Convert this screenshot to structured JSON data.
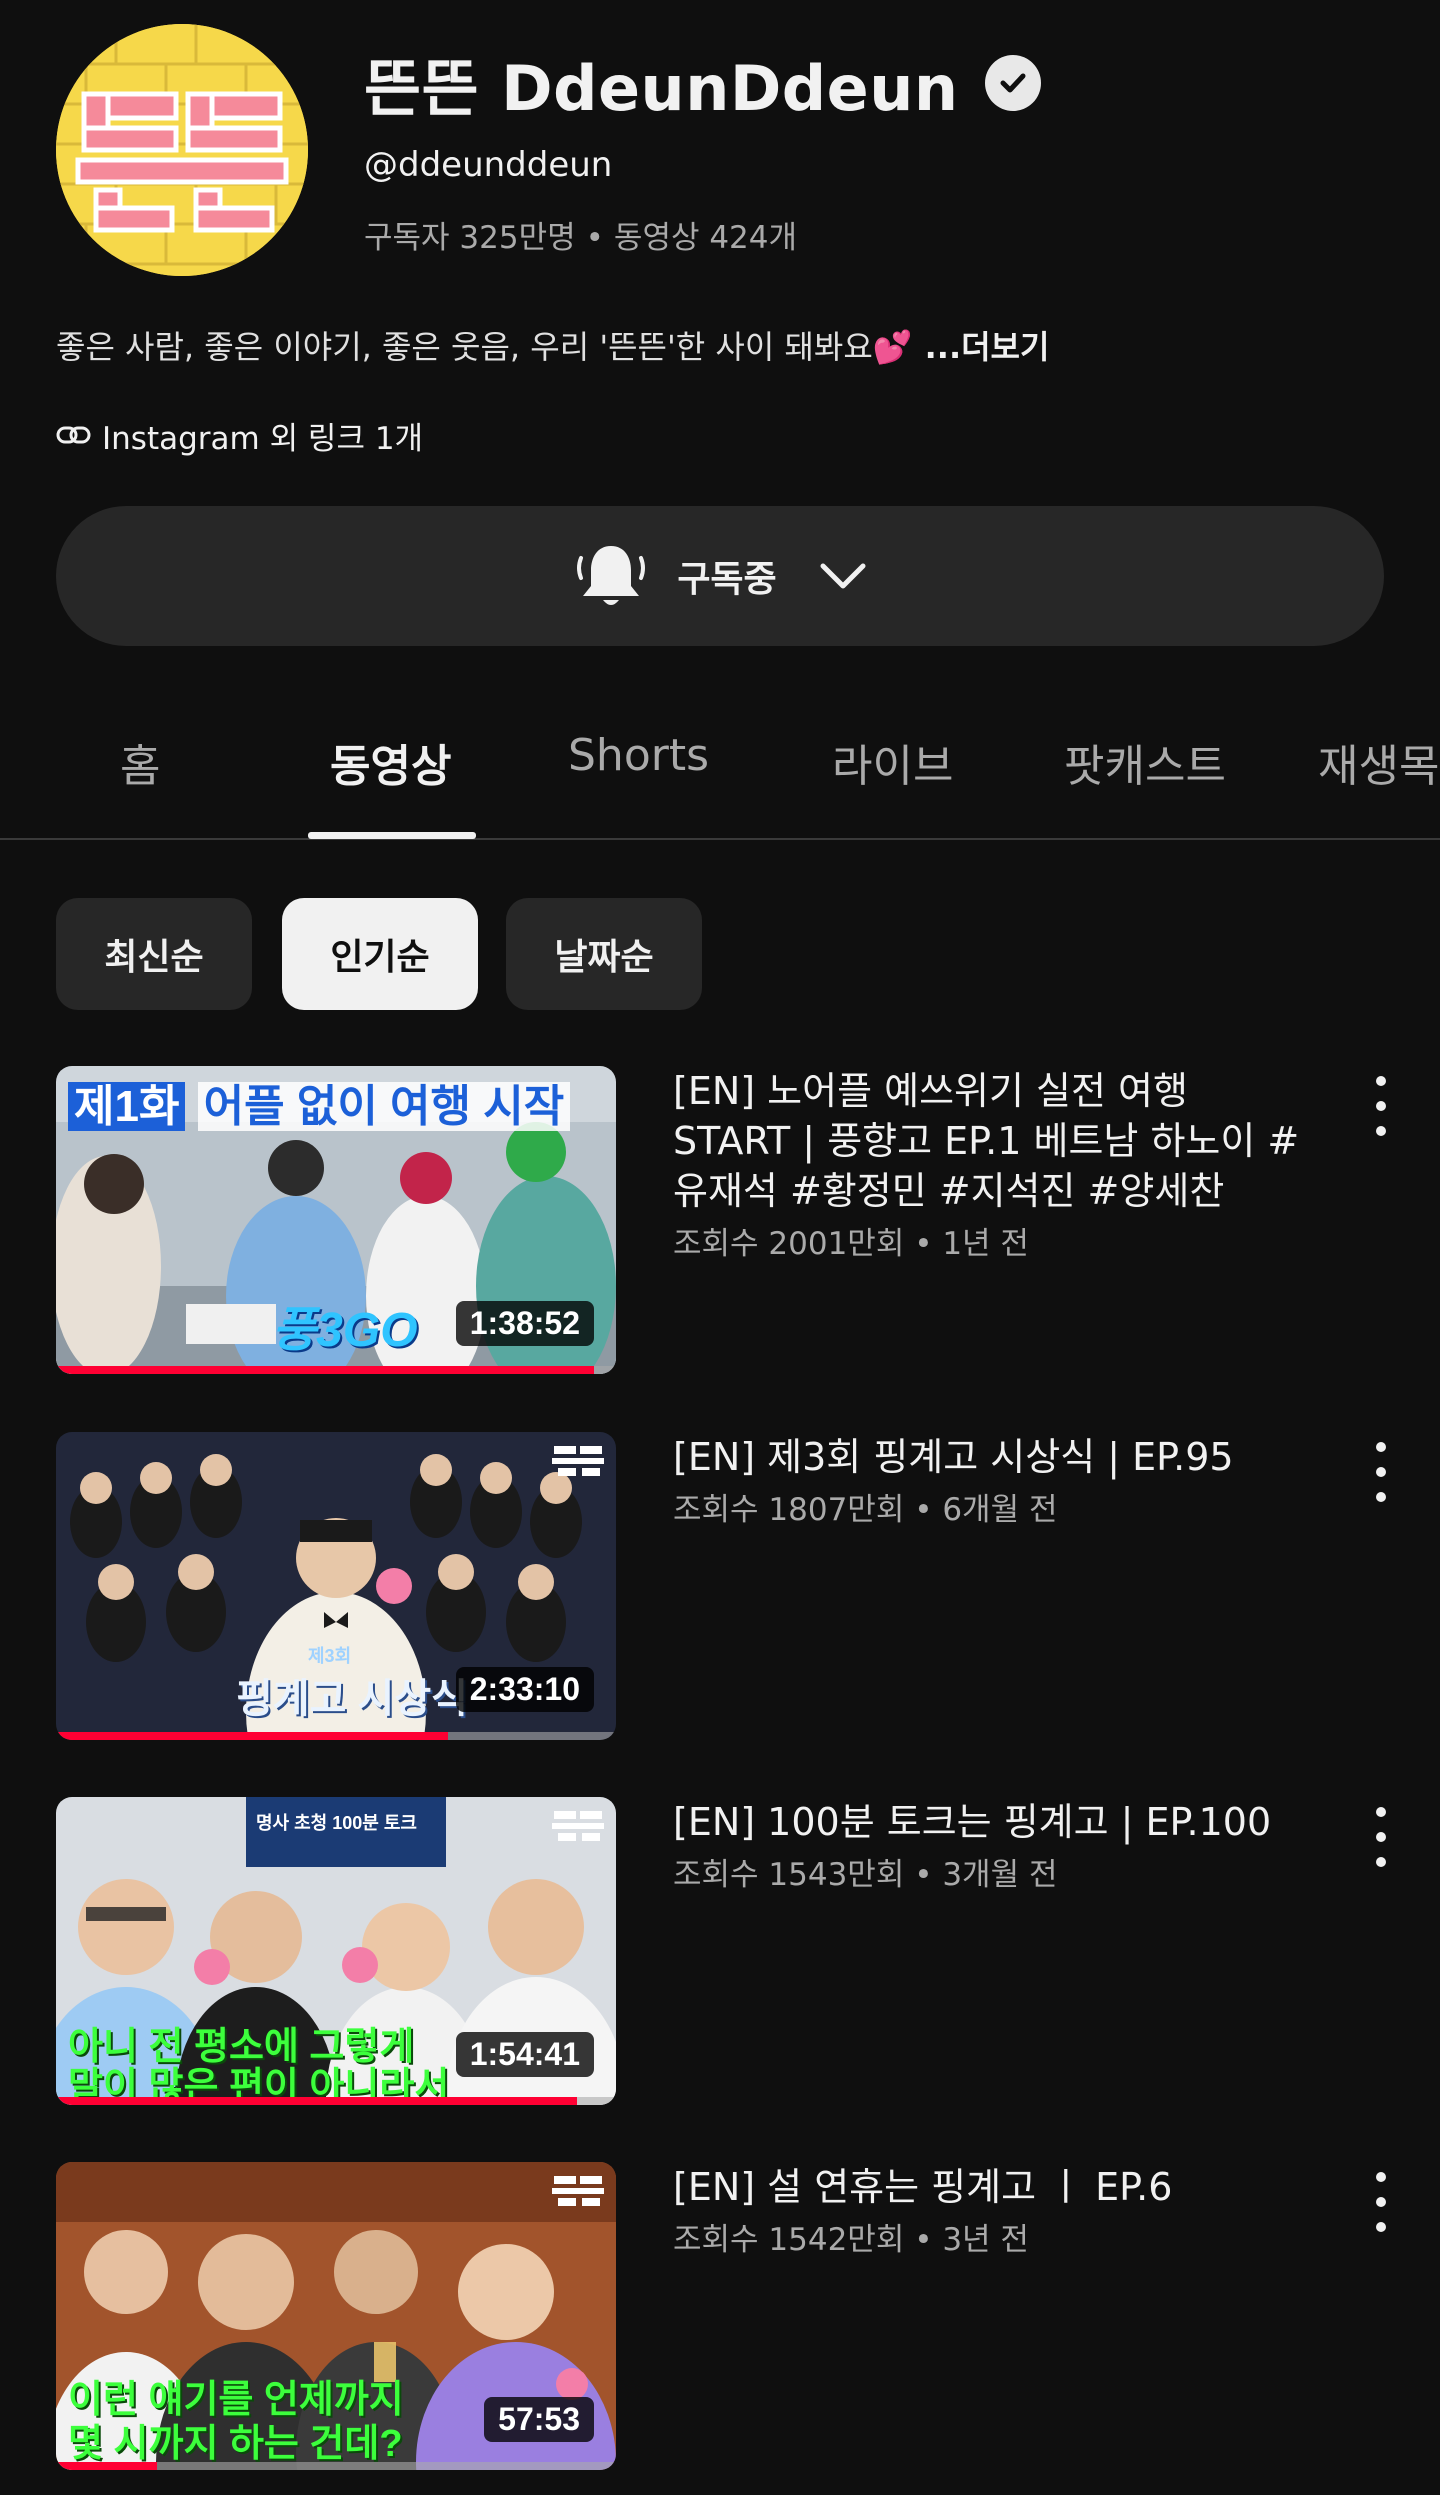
{
  "channel": {
    "name": "뜬뜬 DdeunDdeun",
    "avatar_text": "뜬뜬",
    "handle": "@ddeunddeun",
    "subscribers": "구독자 325만명",
    "video_count": "동영상 424개",
    "stats_separator": "•",
    "description": "좋은 사람, 좋은 이야기, 좋은 웃음, 우리 '뜬뜬'한 사이 돼봐요💕",
    "more_label": "...더보기",
    "links": "Instagram 외 링크 1개"
  },
  "subscribe": {
    "label": "구독중"
  },
  "tabs": [
    "홈",
    "동영상",
    "Shorts",
    "라이브",
    "팟캐스트",
    "재생목록"
  ],
  "sort_chips": [
    "최신순",
    "인기순",
    "날짜순"
  ],
  "videos": [
    {
      "title": "[EN] 노어플 예쓰위기 실전 여행 START | 풍향고 EP.1 베트남 하노이 #유재석 #황정민 #지석진 #양세찬",
      "meta": "조회수 2001만회 • 1년 전",
      "duration": "1:38:52",
      "progress": 0.96,
      "thumb_headline_a": "제1화",
      "thumb_headline_b": "어플 없이 여행 시작",
      "thumb_logo": "풍3GO"
    },
    {
      "title": "[EN] 제3회 핑계고 시상식 | EP.95",
      "meta": "조회수 1807만회 • 6개월 전",
      "duration": "2:33:10",
      "progress": 0.7,
      "thumb_caption_small": "제3회",
      "thumb_caption": "핑계고 시상식"
    },
    {
      "title": "[EN] 100분 토크는 핑계고 | EP.100",
      "meta": "조회수 1543만회 • 3개월 전",
      "duration": "1:54:41",
      "progress": 0.93,
      "thumb_banner": "명사 초청 100분 토크",
      "thumb_line1": "아니 전 평소에 그렇게",
      "thumb_line2": "말이 많은 편이 아니라서"
    },
    {
      "title": "[EN] 설 연휴는 핑계고 ㅣ EP.6",
      "meta": "조회수 1542만회 • 3년 전",
      "duration": "57:53",
      "progress": 0.18,
      "thumb_line1": "이런 얘기를 언제까지",
      "thumb_line2": "몇 시까지 하는 건데?"
    }
  ],
  "colors": {
    "background": "#0f0f0f",
    "surface": "#272727",
    "progress": "#ff0033",
    "caption_green": "#3cff3c",
    "headline_blue": "#1c60d8",
    "avatar_yellow": "#f6d84a",
    "avatar_pink": "#f58a9a"
  }
}
